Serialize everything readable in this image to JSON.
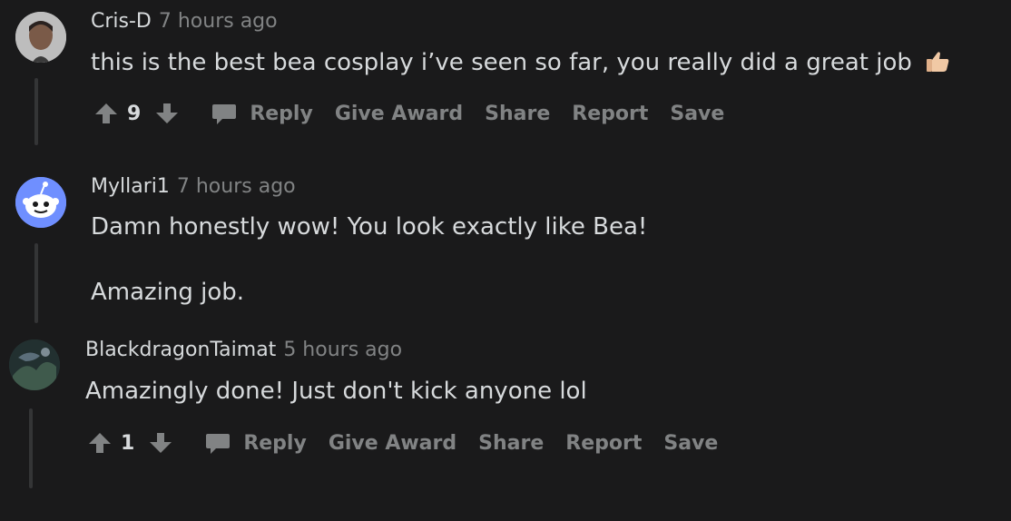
{
  "comments": [
    {
      "author": "Cris-D",
      "time": "7 hours ago",
      "text": "this is the best bea cosplay i’ve seen so far, you really did a great job",
      "emoji": "thumbs-up-emoji",
      "votes": "9",
      "actions": {
        "reply": "Reply",
        "award": "Give Award",
        "share": "Share",
        "report": "Report",
        "save": "Save"
      }
    },
    {
      "author": "Myllari1",
      "time": "7 hours ago",
      "text_line1": "Damn honestly wow! You look exactly like Bea!",
      "text_line2": "Amazing job."
    },
    {
      "author": "BlackdragonTaimat",
      "time": "5 hours ago",
      "text": "Amazingly done! Just don't kick anyone lol",
      "votes": "1",
      "actions": {
        "reply": "Reply",
        "award": "Give Award",
        "share": "Share",
        "report": "Report",
        "save": "Save"
      }
    }
  ]
}
